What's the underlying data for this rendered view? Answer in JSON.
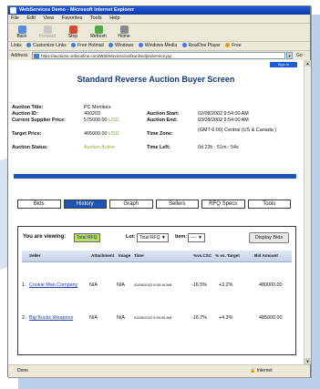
{
  "window": {
    "title": "WebServices Demo - Microsoft Internet Explorer"
  },
  "menu": [
    "File",
    "Edit",
    "View",
    "Favorites",
    "Tools",
    "Help"
  ],
  "toolbar": {
    "back": "Back",
    "forward": "Forward",
    "stop": "Stop",
    "refresh": "Refresh",
    "home": "Home"
  },
  "links": {
    "label": "Links",
    "items": [
      "Customize Links",
      "Free Hotmail",
      "Windows",
      "Windows Media",
      "RealOne Player",
      "Free"
    ]
  },
  "address": {
    "label": "Address",
    "url": "https://auctions.ordisonline.com/WebServices/ordisonline/jeoService.jsp",
    "go": "Go"
  },
  "page": {
    "signin": "Sign In",
    "title": "Standard Reverse Auction Buyer Screen",
    "left": [
      {
        "k": "Auction Title:",
        "v": "PC Monitors",
        "unit": ""
      },
      {
        "k": "Auction ID:",
        "v": "400203",
        "unit": ""
      },
      {
        "k": "Current Supplier Price:",
        "v": "575000.00",
        "unit": "USD"
      },
      {
        "k": "Target Price:",
        "v": "465000.00",
        "unit": "USD"
      },
      {
        "k": "Auction Status:",
        "v": "Auction Active",
        "unit": ""
      }
    ],
    "right": [
      {
        "k": "Auction Start:",
        "v": "02/08/2002 9:54:00 AM"
      },
      {
        "k": "Auction End:",
        "v": "03/08/2002 9:54:00 AM"
      },
      {
        "k": "Time Zone:",
        "v": "(GMT-6:00) Central (US & Canada )"
      },
      {
        "k": "Time Left:",
        "v": "0d  23h : 51m : 54s"
      }
    ],
    "tabs": [
      {
        "label": "Bids",
        "active": false
      },
      {
        "label": "History",
        "active": true
      },
      {
        "label": "Graph",
        "active": false
      },
      {
        "label": "Sellers",
        "active": false
      },
      {
        "label": "RFQ Specs",
        "active": false
      },
      {
        "label": "Tools",
        "active": false
      }
    ],
    "viewing": {
      "label": "You are viewing:",
      "value": "Total RFQ",
      "lot_label": "Lot:",
      "lot_value": "Total RFQ",
      "item_label": "Item:",
      "item_value": "----",
      "button": "Display Bids"
    },
    "table": {
      "headers": [
        "Seller",
        "Attachment",
        "Image",
        "Time",
        "%vs.CSC",
        "% vs. Target",
        "Bid Amount"
      ],
      "rows": [
        {
          "n": "1.",
          "seller": "Cookie Man Company",
          "attach": "N/A",
          "image": "N/A",
          "time": "02/08/2002 9:55:18 AM",
          "csc": "-16.5%",
          "target": "+3.2%",
          "bid": "480000.00"
        },
        {
          "n": "2.",
          "seller": "Big Bucks Weapons",
          "attach": "N/A",
          "image": "N/A",
          "time": "02/08/2002 9:55:36 AM",
          "csc": "-16.7%",
          "target": "+4.3%",
          "bid": "485000.00"
        }
      ]
    }
  },
  "status": {
    "left": "Done",
    "zone": "Internet"
  },
  "colors": {
    "accent": "#1d55b5",
    "titlebar": "#0a3aa8",
    "status_green": "#7bb02a",
    "selected_box": "#b7e06a"
  }
}
